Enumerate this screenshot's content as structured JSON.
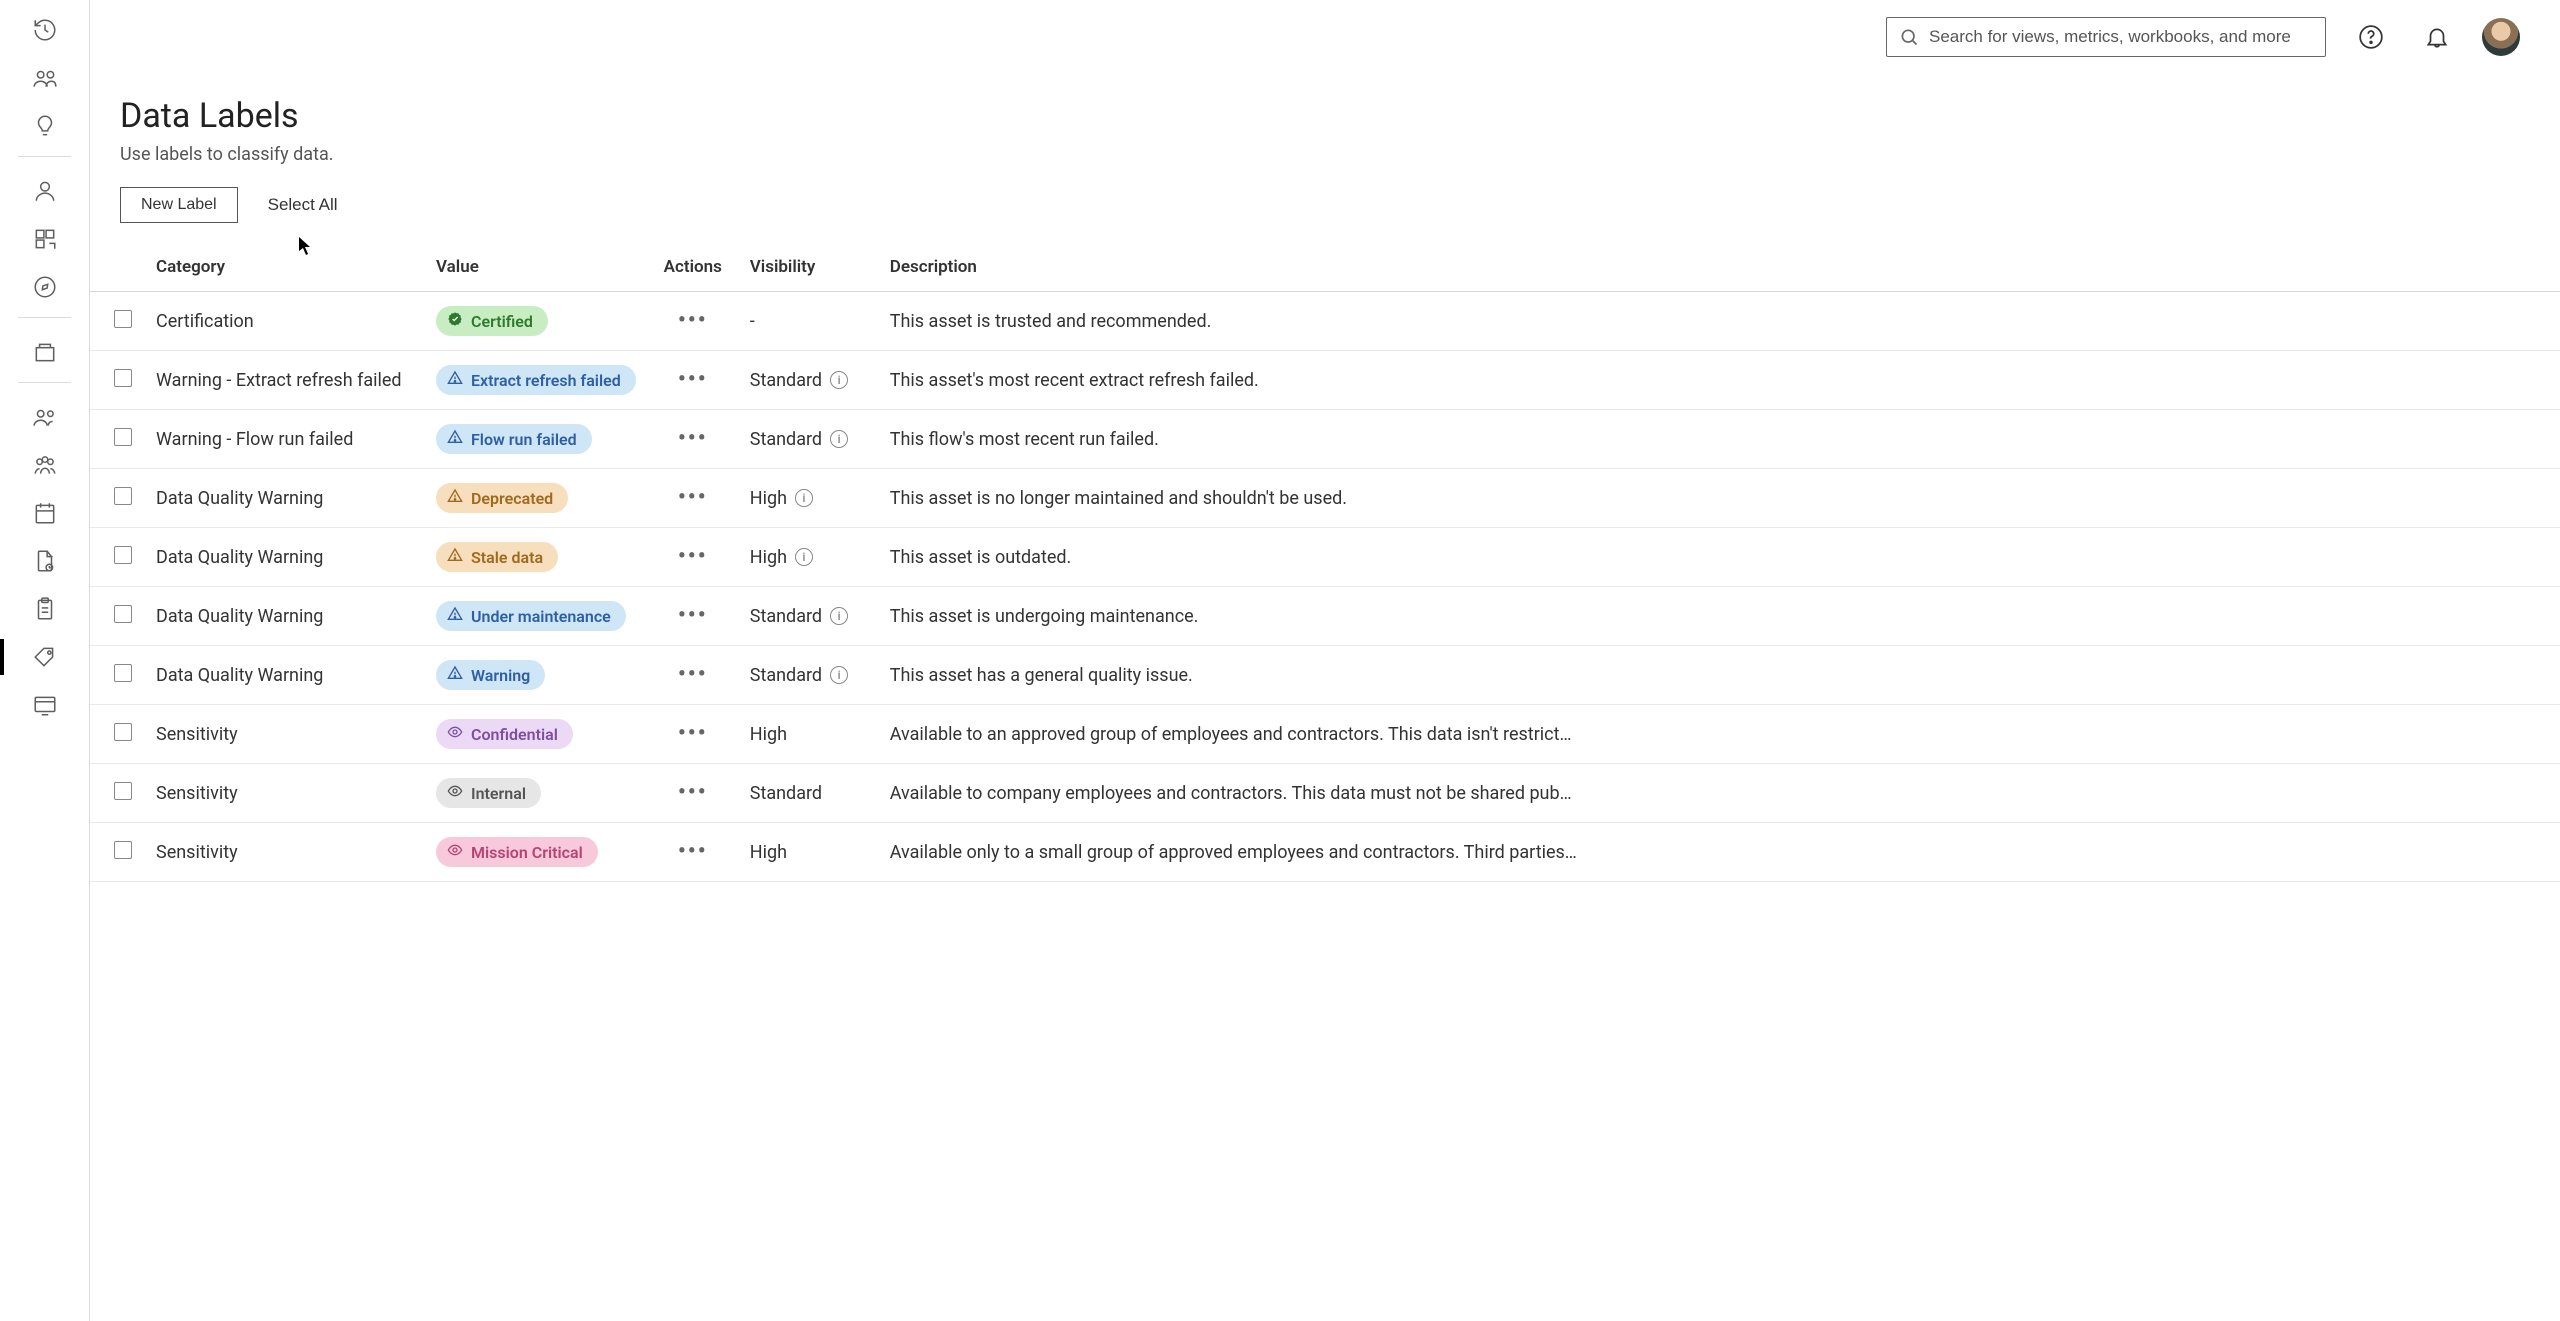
{
  "page": {
    "title": "Data Labels",
    "subtitle": "Use labels to classify data."
  },
  "search": {
    "placeholder": "Search for views, metrics, workbooks, and more"
  },
  "actions": {
    "new_label": "New Label",
    "select_all": "Select All"
  },
  "table": {
    "headers": {
      "category": "Category",
      "value": "Value",
      "actions": "Actions",
      "visibility": "Visibility",
      "description": "Description"
    },
    "rows": [
      {
        "category": "Certification",
        "value_label": "Certified",
        "value_style": "green",
        "value_icon": "check-badge",
        "visibility": "-",
        "info": false,
        "description": "This asset is trusted and recommended."
      },
      {
        "category": "Warning - Extract refresh failed",
        "value_label": "Extract refresh failed",
        "value_style": "blue",
        "value_icon": "warning",
        "visibility": "Standard",
        "info": true,
        "description": "This asset's most recent extract refresh failed."
      },
      {
        "category": "Warning - Flow run failed",
        "value_label": "Flow run failed",
        "value_style": "blue",
        "value_icon": "warning",
        "visibility": "Standard",
        "info": true,
        "description": "This flow's most recent run failed."
      },
      {
        "category": "Data Quality Warning",
        "value_label": "Deprecated",
        "value_style": "orange",
        "value_icon": "warning",
        "visibility": "High",
        "info": true,
        "description": "This asset is no longer maintained and shouldn't be used."
      },
      {
        "category": "Data Quality Warning",
        "value_label": "Stale data",
        "value_style": "orange",
        "value_icon": "warning",
        "visibility": "High",
        "info": true,
        "description": "This asset is outdated."
      },
      {
        "category": "Data Quality Warning",
        "value_label": "Under maintenance",
        "value_style": "blue",
        "value_icon": "warning",
        "visibility": "Standard",
        "info": true,
        "description": "This asset is undergoing maintenance."
      },
      {
        "category": "Data Quality Warning",
        "value_label": "Warning",
        "value_style": "blue",
        "value_icon": "warning",
        "visibility": "Standard",
        "info": true,
        "description": "This asset has a general quality issue."
      },
      {
        "category": "Sensitivity",
        "value_label": "Confidential",
        "value_style": "purple",
        "value_icon": "eye",
        "visibility": "High",
        "info": false,
        "description": "Available to an approved group of employees and contractors. This data isn't restrict…"
      },
      {
        "category": "Sensitivity",
        "value_label": "Internal",
        "value_style": "grey",
        "value_icon": "eye",
        "visibility": "Standard",
        "info": false,
        "description": "Available to company employees and contractors. This data must not be shared pub…"
      },
      {
        "category": "Sensitivity",
        "value_label": "Mission Critical",
        "value_style": "pink",
        "value_icon": "eye",
        "visibility": "High",
        "info": false,
        "description": "Available only to a small group of approved employees and contractors. Third parties…"
      }
    ]
  },
  "sidebar_icons": [
    "history-icon",
    "shared-icon",
    "recommendations-icon",
    "user-icon",
    "external-assets-icon",
    "explore-icon",
    "collections-icon",
    "users-icon",
    "groups-icon",
    "schedules-icon",
    "jobs-icon",
    "tasks-icon",
    "labels-icon",
    "site-status-icon"
  ],
  "selected_sidebar": "labels-icon"
}
